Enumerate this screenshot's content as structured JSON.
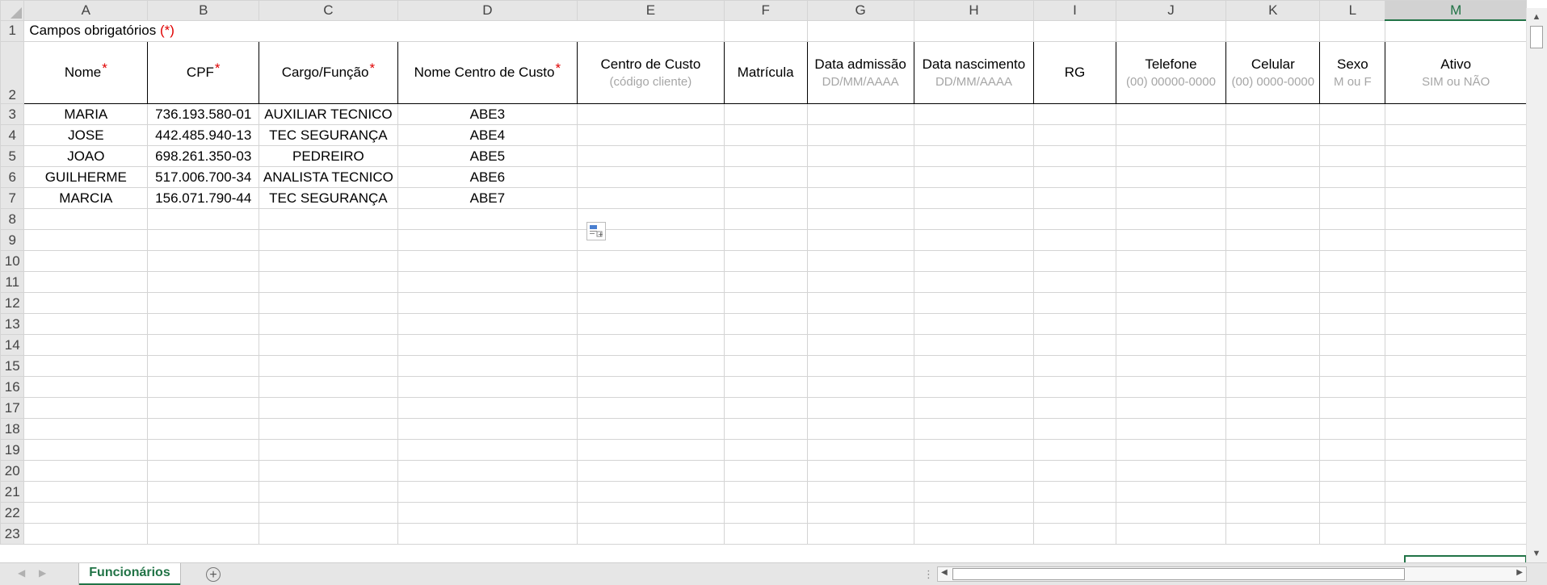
{
  "columns": [
    "A",
    "B",
    "C",
    "D",
    "E",
    "F",
    "G",
    "H",
    "I",
    "J",
    "K",
    "L",
    "M"
  ],
  "selected_column": "M",
  "row_numbers": [
    "1",
    "2",
    "3",
    "4",
    "5",
    "6",
    "7",
    "8",
    "9",
    "10",
    "11",
    "12",
    "13",
    "14",
    "15",
    "16",
    "17",
    "18",
    "19",
    "20",
    "21",
    "22",
    "23"
  ],
  "title": {
    "text": "Campos obrigatórios ",
    "marker": "(*)"
  },
  "headers": [
    {
      "label": "Nome",
      "required": true,
      "sub": ""
    },
    {
      "label": "CPF",
      "required": true,
      "sub": ""
    },
    {
      "label": "Cargo/Função",
      "required": true,
      "sub": ""
    },
    {
      "label": "Nome Centro de Custo",
      "required": true,
      "sub": ""
    },
    {
      "label": "Centro de Custo",
      "required": false,
      "sub": "(código cliente)"
    },
    {
      "label": "Matrícula",
      "required": false,
      "sub": ""
    },
    {
      "label": "Data admissão",
      "required": false,
      "sub": "DD/MM/AAAA"
    },
    {
      "label": "Data nascimento",
      "required": false,
      "sub": "DD/MM/AAAA"
    },
    {
      "label": "RG",
      "required": false,
      "sub": ""
    },
    {
      "label": "Telefone",
      "required": false,
      "sub": "(00) 00000-0000"
    },
    {
      "label": "Celular",
      "required": false,
      "sub": "(00) 0000-0000"
    },
    {
      "label": "Sexo",
      "required": false,
      "sub": "M ou F"
    },
    {
      "label": "Ativo",
      "required": false,
      "sub": "SIM ou NÃO"
    }
  ],
  "rows": [
    [
      "MARIA",
      "736.193.580-01",
      "AUXILIAR TECNICO",
      "ABE3"
    ],
    [
      "JOSE",
      "442.485.940-13",
      "TEC SEGURANÇA",
      "ABE4"
    ],
    [
      "JOAO",
      "698.261.350-03",
      "PEDREIRO",
      "ABE5"
    ],
    [
      "GUILHERME",
      "517.006.700-34",
      "ANALISTA TECNICO",
      "ABE6"
    ],
    [
      "MARCIA",
      "156.071.790-44",
      "TEC SEGURANÇA",
      "ABE7"
    ]
  ],
  "required_marker": "*",
  "sheet_tab": "Funcionários",
  "icons": [
    "select-all-triangle",
    "paste-options-icon",
    "add-sheet-icon",
    "scroll-up-arrow",
    "scroll-down-arrow",
    "scroll-left-arrow",
    "scroll-right-arrow"
  ],
  "accent_color": "#217346"
}
